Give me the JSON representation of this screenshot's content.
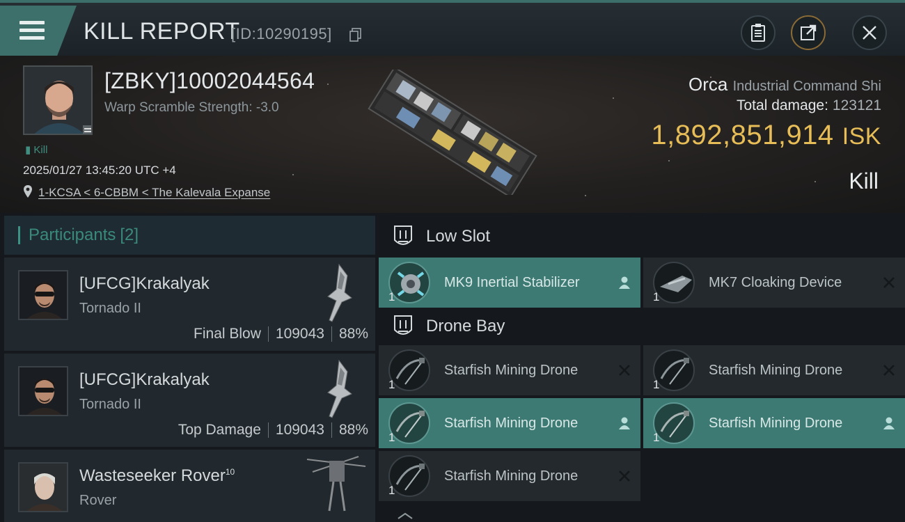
{
  "header": {
    "title": "KILL REPORT",
    "report_id": "[ID:10290195]",
    "buttons": [
      "clipboard-icon",
      "share-icon",
      "close-icon"
    ]
  },
  "victim": {
    "name": "[ZBKY]10002044564",
    "warp_scramble": "Warp Scramble Strength: -3.0",
    "kill_tag": "Kill",
    "timestamp": "2025/01/27 13:45:20 UTC +4",
    "location": "1-KCSA < 6-CBBM < The Kalevala Expanse"
  },
  "ship": {
    "name": "Orca",
    "class": "Industrial Command Shi",
    "total_damage_label": "Total damage:",
    "total_damage": "123121",
    "isk_value": "1,892,851,914",
    "isk_unit": "ISK",
    "result": "Kill"
  },
  "participants": {
    "label": "Participants",
    "count": "[2]",
    "rows": [
      {
        "name": "[UFCG]Krakalyak",
        "ship": "Tornado II",
        "role": "Final Blow",
        "damage": "109043",
        "percent": "88%"
      },
      {
        "name": "[UFCG]Krakalyak",
        "ship": "Tornado II",
        "role": "Top Damage",
        "damage": "109043",
        "percent": "88%"
      },
      {
        "name": "Wasteseeker Rover",
        "name_sup": "10",
        "ship": "Rover"
      }
    ]
  },
  "low_slot": {
    "label": "Low Slot",
    "items": [
      {
        "name": "MK9 Inertial Stabilizer",
        "qty": "1",
        "status": "dropped"
      },
      {
        "name": "MK7 Cloaking Device",
        "qty": "1",
        "status": "destroyed"
      }
    ]
  },
  "drone_bay": {
    "label": "Drone Bay",
    "items": [
      {
        "name": "Starfish Mining Drone",
        "qty": "1",
        "status": "destroyed"
      },
      {
        "name": "Starfish Mining Drone",
        "qty": "1",
        "status": "destroyed"
      },
      {
        "name": "Starfish Mining Drone",
        "qty": "1",
        "status": "dropped"
      },
      {
        "name": "Starfish Mining Drone",
        "qty": "1",
        "status": "dropped"
      },
      {
        "name": "Starfish Mining Drone",
        "qty": "1",
        "status": "destroyed"
      }
    ]
  },
  "colors": {
    "accent_teal": "#3d6f6b",
    "dropped_bg": "#3e7a74",
    "isk_gold": "#e7bd58"
  }
}
